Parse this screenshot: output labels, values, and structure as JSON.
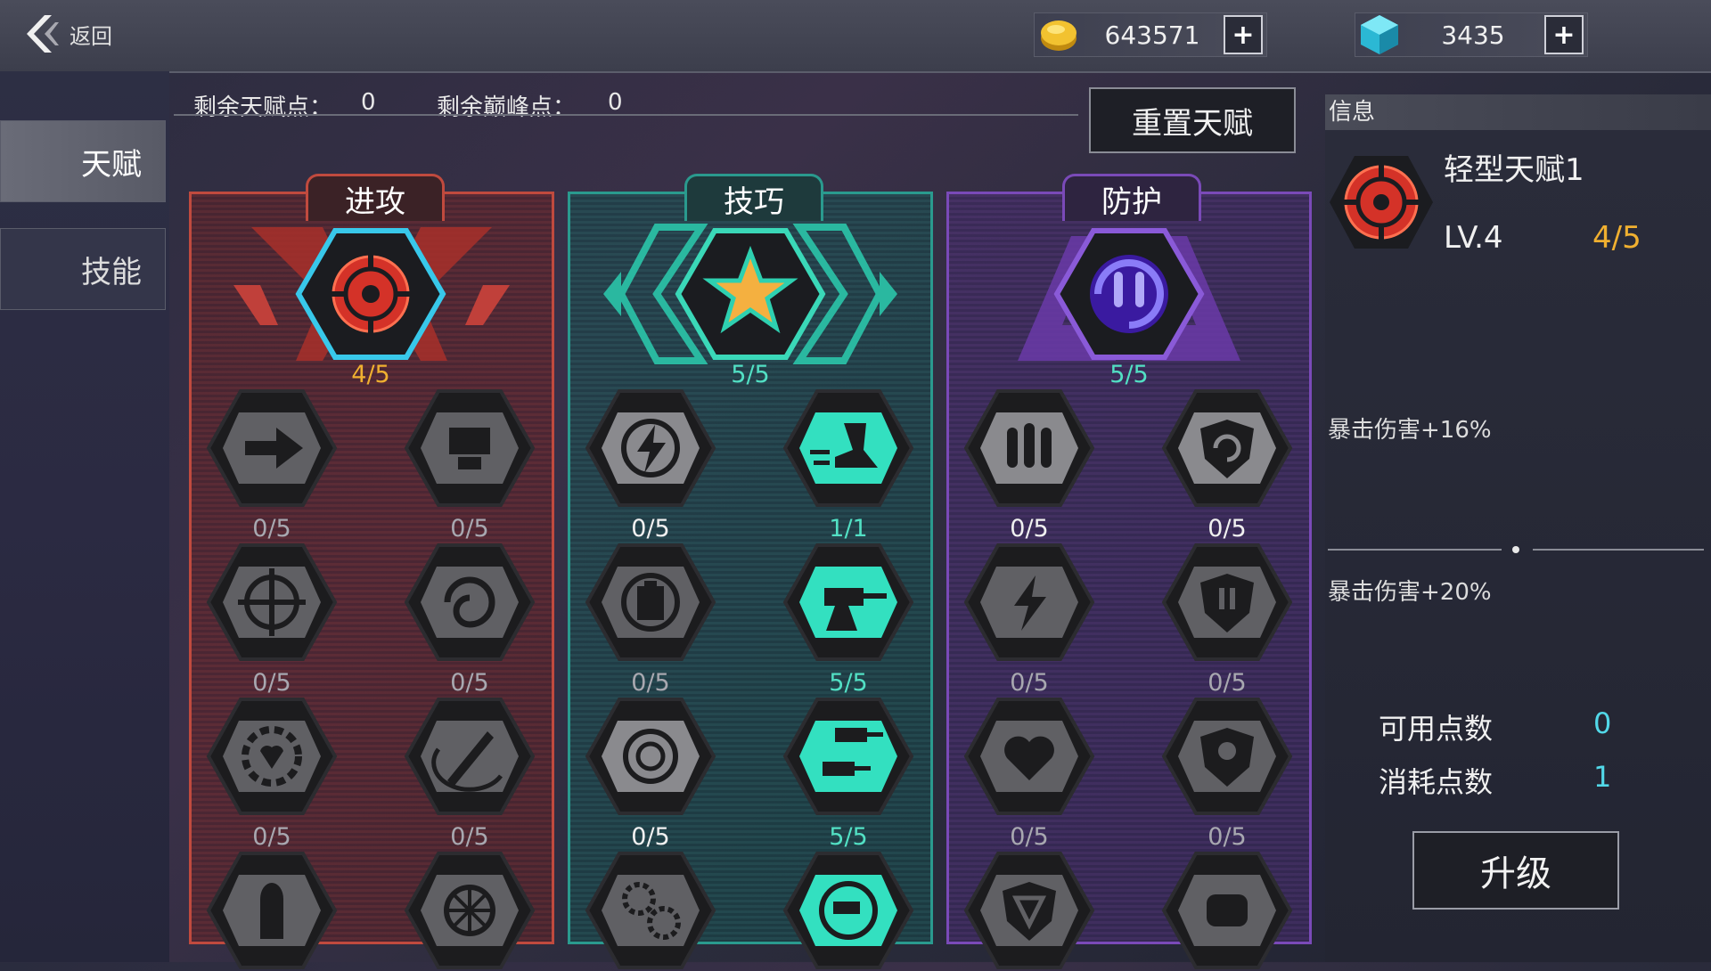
{
  "header": {
    "back_label": "返回",
    "gold": {
      "value": "643571",
      "add_label": "+",
      "color": "#f2c230"
    },
    "gem": {
      "value": "3435",
      "add_label": "+",
      "color": "#3fd6e8"
    }
  },
  "sidebar": {
    "tabs": [
      {
        "label": "天赋",
        "active": true
      },
      {
        "label": "技能",
        "active": false
      }
    ]
  },
  "points": {
    "talent_label": "剩余天赋点：",
    "talent_value": "0",
    "peak_label": "剩余巅峰点：",
    "peak_value": "0",
    "reset_label": "重置天赋"
  },
  "columns": [
    {
      "title": "进攻",
      "theme": "#c04a3e",
      "top_icon": "crosshair-target-icon",
      "top_count": "4/5",
      "rows": [
        [
          {
            "icon": "arrow-dash-icon",
            "count": "0/5"
          },
          {
            "icon": "skull-icon",
            "count": "0/5"
          }
        ],
        [
          {
            "icon": "crosshair-icon",
            "count": "0/5"
          },
          {
            "icon": "swirl-icon",
            "count": "0/5"
          }
        ],
        [
          {
            "icon": "gear-heart-icon",
            "count": "0/5"
          },
          {
            "icon": "sword-slash-icon",
            "count": "0/5"
          }
        ],
        [
          {
            "icon": "bullet-icon",
            "count": ""
          },
          {
            "icon": "wheel-icon",
            "count": ""
          }
        ]
      ]
    },
    {
      "title": "技巧",
      "theme": "#2a9a8e",
      "top_icon": "star-icon",
      "top_count": "5/5",
      "rows": [
        [
          {
            "icon": "lightning-cycle-icon",
            "count": "0/5"
          },
          {
            "icon": "boot-dash-icon",
            "count": "1/1"
          }
        ],
        [
          {
            "icon": "battery-cycle-icon",
            "count": "0/5"
          },
          {
            "icon": "turret-icon",
            "count": "5/5"
          }
        ],
        [
          {
            "icon": "vault-icon",
            "count": "0/5"
          },
          {
            "icon": "double-turret-icon",
            "count": "5/5"
          }
        ],
        [
          {
            "icon": "gears-icon",
            "count": ""
          },
          {
            "icon": "turret-cycle-icon",
            "count": ""
          }
        ]
      ]
    },
    {
      "title": "防护",
      "theme": "#7a4ab8",
      "top_icon": "missile-cycle-icon",
      "top_count": "5/5",
      "rows": [
        [
          {
            "icon": "missiles-icon",
            "count": "0/5"
          },
          {
            "icon": "shield-swirl-icon",
            "count": "0/5"
          }
        ],
        [
          {
            "icon": "lightning-arrows-icon",
            "count": "0/5"
          },
          {
            "icon": "shield-missile-icon",
            "count": "0/5"
          }
        ],
        [
          {
            "icon": "heart-cross-icon",
            "count": "0/5"
          },
          {
            "icon": "shield-skull-icon",
            "count": "0/5"
          }
        ],
        [
          {
            "icon": "shield-v-icon",
            "count": ""
          },
          {
            "icon": "fist-icon",
            "count": ""
          }
        ]
      ]
    }
  ],
  "info": {
    "title": "信息",
    "talent_name": "轻型天赋1",
    "level": "LV.4",
    "progress": "4/5",
    "current_effect": "暴击伤害+16%",
    "next_effect": "暴击伤害+20%",
    "available_label": "可用点数",
    "available_value": "0",
    "cost_label": "消耗点数",
    "cost_value": "1",
    "upgrade_label": "升级"
  }
}
